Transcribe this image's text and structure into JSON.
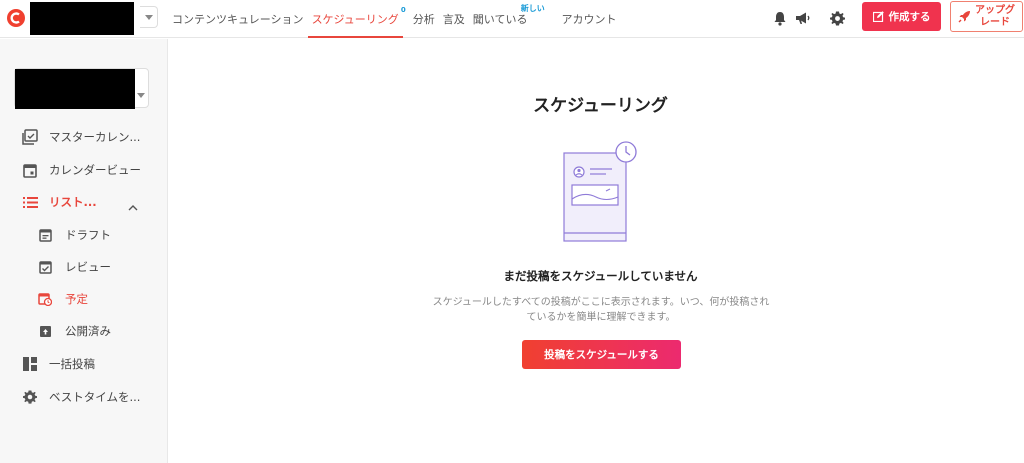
{
  "topbar": {
    "nav": [
      {
        "label": "コンテンツキュレーション"
      },
      {
        "label": "スケジューリング",
        "badge": "0"
      },
      {
        "label": "分析"
      },
      {
        "label": "言及"
      },
      {
        "label": "聞いている",
        "badge": "新しい"
      },
      {
        "label": "アカウント"
      }
    ],
    "create_label": "作成する",
    "upgrade_label_1": "アップグ",
    "upgrade_label_2": "レード",
    "icons": [
      "bell-icon",
      "megaphone-icon",
      "gear-icon"
    ]
  },
  "sidebar": {
    "items": [
      {
        "label": "マスターカレン..."
      },
      {
        "label": "カレンダービュー"
      },
      {
        "label": "リスト..."
      },
      {
        "label": "一括投稿"
      },
      {
        "label": "ベストタイムを..."
      }
    ],
    "sub_items": [
      {
        "label": "ドラフト"
      },
      {
        "label": "レビュー"
      },
      {
        "label": "予定"
      },
      {
        "label": "公開済み"
      }
    ]
  },
  "main": {
    "title": "スケジューリング",
    "empty_heading": "まだ投稿をスケジュールしていません",
    "empty_desc": "スケジュールしたすべての投稿がここに表示されます。いつ、何が投稿されているかを簡単に理解できます。",
    "cta_label": "投稿をスケジュールする"
  },
  "colors": {
    "accent": "#e8463c",
    "cta_start": "#f04030",
    "cta_end": "#ec2a6f",
    "illustration": "#8f7bd8"
  }
}
